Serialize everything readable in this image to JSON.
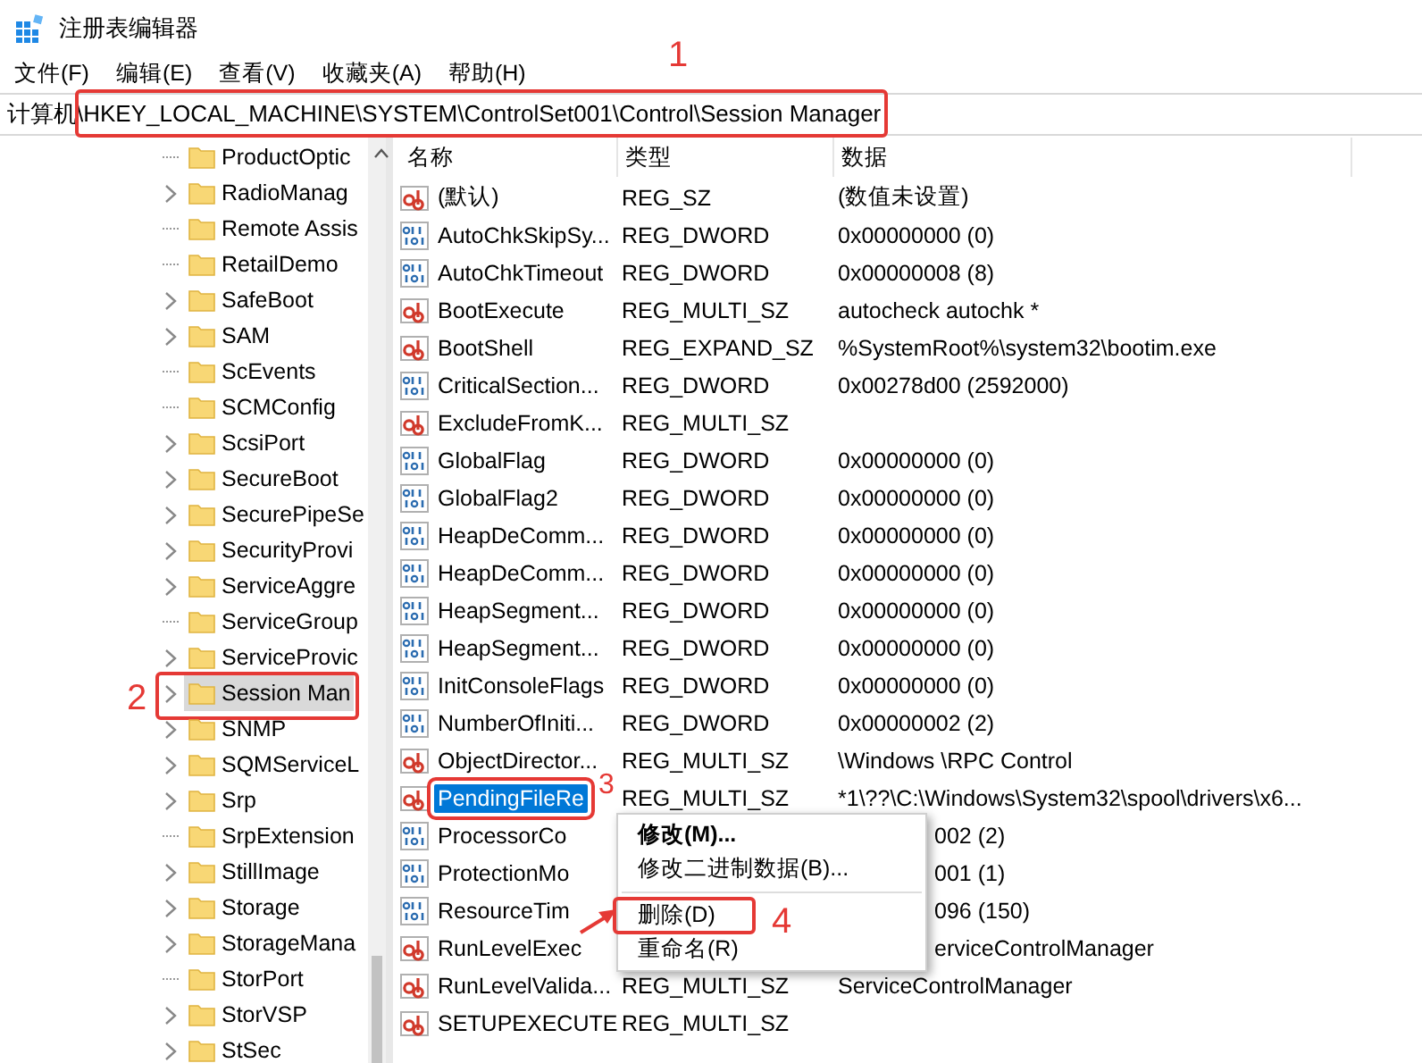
{
  "window": {
    "title": "注册表编辑器"
  },
  "menu": [
    "文件(F)",
    "编辑(E)",
    "查看(V)",
    "收藏夹(A)",
    "帮助(H)"
  ],
  "address": {
    "value": "计算机\\HKEY_LOCAL_MACHINE\\SYSTEM\\ControlSet001\\Control\\Session Manager",
    "step": "1"
  },
  "tree": {
    "items": [
      {
        "label": "ProductOptic",
        "expandable": false,
        "selected": false
      },
      {
        "label": "RadioManag",
        "expandable": true,
        "selected": false
      },
      {
        "label": "Remote Assis",
        "expandable": false,
        "selected": false
      },
      {
        "label": "RetailDemo",
        "expandable": false,
        "selected": false
      },
      {
        "label": "SafeBoot",
        "expandable": true,
        "selected": false
      },
      {
        "label": "SAM",
        "expandable": true,
        "selected": false
      },
      {
        "label": "ScEvents",
        "expandable": false,
        "selected": false
      },
      {
        "label": "SCMConfig",
        "expandable": false,
        "selected": false
      },
      {
        "label": "ScsiPort",
        "expandable": true,
        "selected": false
      },
      {
        "label": "SecureBoot",
        "expandable": true,
        "selected": false
      },
      {
        "label": "SecurePipeSe",
        "expandable": true,
        "selected": false
      },
      {
        "label": "SecurityProvi",
        "expandable": true,
        "selected": false
      },
      {
        "label": "ServiceAggre",
        "expandable": true,
        "selected": false
      },
      {
        "label": "ServiceGroup",
        "expandable": false,
        "selected": false
      },
      {
        "label": "ServiceProvic",
        "expandable": true,
        "selected": false
      },
      {
        "label": "Session Man",
        "expandable": true,
        "selected": true,
        "step": "2"
      },
      {
        "label": "SNMP",
        "expandable": true,
        "selected": false
      },
      {
        "label": "SQMServiceL",
        "expandable": true,
        "selected": false
      },
      {
        "label": "Srp",
        "expandable": true,
        "selected": false
      },
      {
        "label": "SrpExtension",
        "expandable": false,
        "selected": false
      },
      {
        "label": "StillImage",
        "expandable": true,
        "selected": false
      },
      {
        "label": "Storage",
        "expandable": true,
        "selected": false
      },
      {
        "label": "StorageMana",
        "expandable": true,
        "selected": false
      },
      {
        "label": "StorPort",
        "expandable": false,
        "selected": false
      },
      {
        "label": "StorVSP",
        "expandable": true,
        "selected": false
      },
      {
        "label": "StSec",
        "expandable": true,
        "selected": false
      }
    ]
  },
  "values": {
    "columns": [
      "名称",
      "类型",
      "数据"
    ],
    "rows": [
      {
        "kind": "sz",
        "name": "(默认)",
        "type": "REG_SZ",
        "data": "(数值未设置)",
        "selected": false
      },
      {
        "kind": "dword",
        "name": "AutoChkSkipSy...",
        "type": "REG_DWORD",
        "data": "0x00000000 (0)",
        "selected": false
      },
      {
        "kind": "dword",
        "name": "AutoChkTimeout",
        "type": "REG_DWORD",
        "data": "0x00000008 (8)",
        "selected": false
      },
      {
        "kind": "sz",
        "name": "BootExecute",
        "type": "REG_MULTI_SZ",
        "data": "autocheck autochk *",
        "selected": false
      },
      {
        "kind": "sz",
        "name": "BootShell",
        "type": "REG_EXPAND_SZ",
        "data": "%SystemRoot%\\system32\\bootim.exe",
        "selected": false
      },
      {
        "kind": "dword",
        "name": "CriticalSection...",
        "type": "REG_DWORD",
        "data": "0x00278d00 (2592000)",
        "selected": false
      },
      {
        "kind": "sz",
        "name": "ExcludeFromK...",
        "type": "REG_MULTI_SZ",
        "selected": false
      },
      {
        "kind": "dword",
        "name": "GlobalFlag",
        "type": "REG_DWORD",
        "data": "0x00000000 (0)",
        "selected": false
      },
      {
        "kind": "dword",
        "name": "GlobalFlag2",
        "type": "REG_DWORD",
        "data": "0x00000000 (0)",
        "selected": false
      },
      {
        "kind": "dword",
        "name": "HeapDeComm...",
        "type": "REG_DWORD",
        "data": "0x00000000 (0)",
        "selected": false
      },
      {
        "kind": "dword",
        "name": "HeapDeComm...",
        "type": "REG_DWORD",
        "data": "0x00000000 (0)",
        "selected": false
      },
      {
        "kind": "dword",
        "name": "HeapSegment...",
        "type": "REG_DWORD",
        "data": "0x00000000 (0)",
        "selected": false
      },
      {
        "kind": "dword",
        "name": "HeapSegment...",
        "type": "REG_DWORD",
        "data": "0x00000000 (0)",
        "selected": false
      },
      {
        "kind": "dword",
        "name": "InitConsoleFlags",
        "type": "REG_DWORD",
        "data": "0x00000000 (0)",
        "selected": false
      },
      {
        "kind": "dword",
        "name": "NumberOfIniti...",
        "type": "REG_DWORD",
        "data": "0x00000002 (2)",
        "selected": false
      },
      {
        "kind": "sz",
        "name": "ObjectDirector...",
        "type": "REG_MULTI_SZ",
        "data": "\\Windows \\RPC Control",
        "selected": false
      },
      {
        "kind": "sz",
        "name": "PendingFileRe",
        "type": "REG_MULTI_SZ",
        "data": "*1\\??\\C:\\Windows\\System32\\spool\\drivers\\x6...",
        "selected": true,
        "step": "3"
      },
      {
        "kind": "dword",
        "name": "ProcessorCo",
        "data": "002 (2)",
        "selected": false,
        "covered": true
      },
      {
        "kind": "dword",
        "name": "ProtectionMo",
        "data": "001 (1)",
        "selected": false,
        "covered": true
      },
      {
        "kind": "dword",
        "name": "ResourceTim",
        "data": "096 (150)",
        "selected": false,
        "covered": true
      },
      {
        "kind": "sz",
        "name": "RunLevelExec",
        "data": "erviceControlManager",
        "selected": false,
        "covered": true
      },
      {
        "kind": "sz",
        "name": "RunLevelValida...",
        "type": "REG_MULTI_SZ",
        "data": "ServiceControlManager",
        "selected": false
      },
      {
        "kind": "sz",
        "name": "SETUPEXECUTE",
        "type": "REG_MULTI_SZ",
        "selected": false
      }
    ]
  },
  "context_menu": {
    "items": [
      {
        "kind": "default",
        "label": "修改(M)..."
      },
      {
        "kind": "item",
        "label": "修改二进制数据(B)..."
      },
      {
        "kind": "separator"
      },
      {
        "kind": "item",
        "label": "删除(D)",
        "step": "4",
        "arrow": true
      },
      {
        "kind": "item",
        "label": "重命名(R)"
      }
    ]
  }
}
